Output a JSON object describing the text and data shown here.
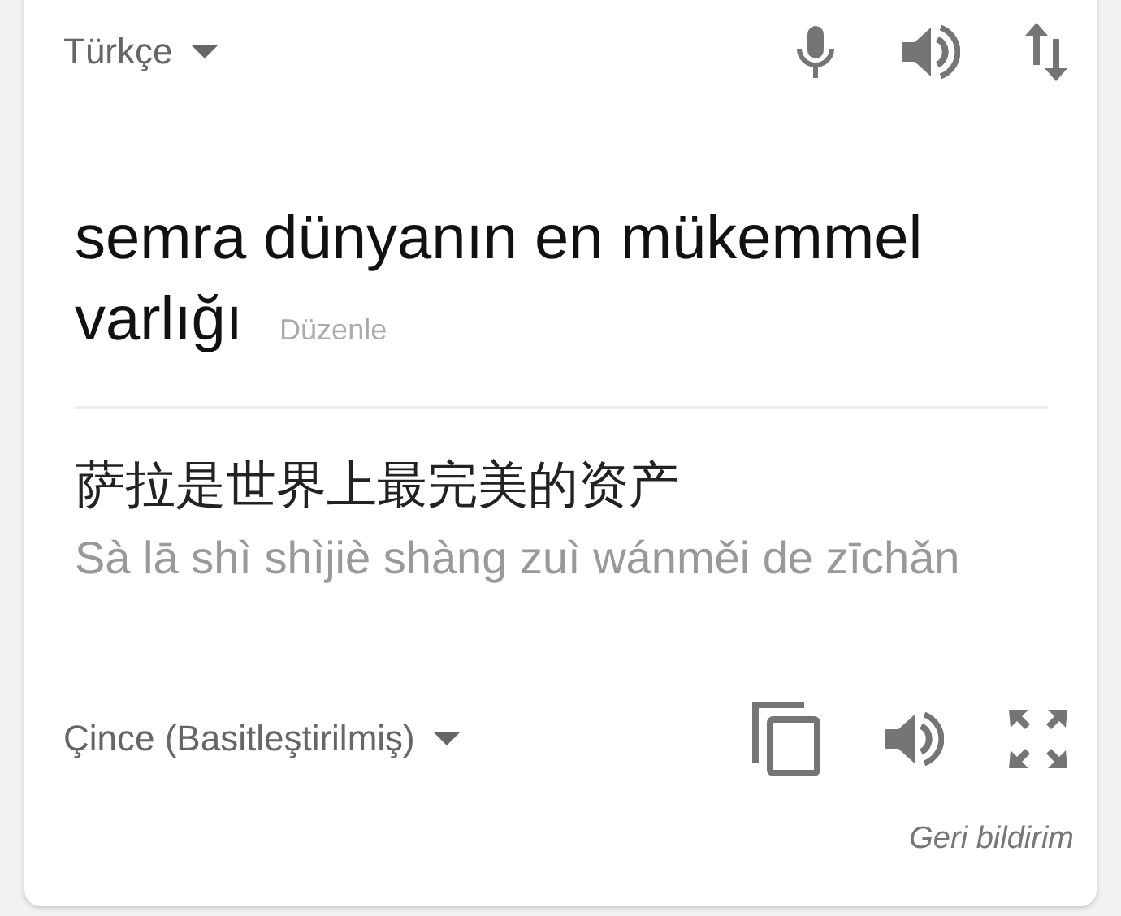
{
  "source": {
    "language": "Türkçe",
    "text": "semra dünyanın en mükemmel varlığı",
    "edit_label": "Düzenle"
  },
  "translation": {
    "text": "萨拉是世界上最完美的资产",
    "romanization": "Sà lā shì shìjiè shàng zuì wánměi de zīchǎn",
    "language": "Çince (Basitleştirilmiş)"
  },
  "feedback": "Geri bildirim"
}
